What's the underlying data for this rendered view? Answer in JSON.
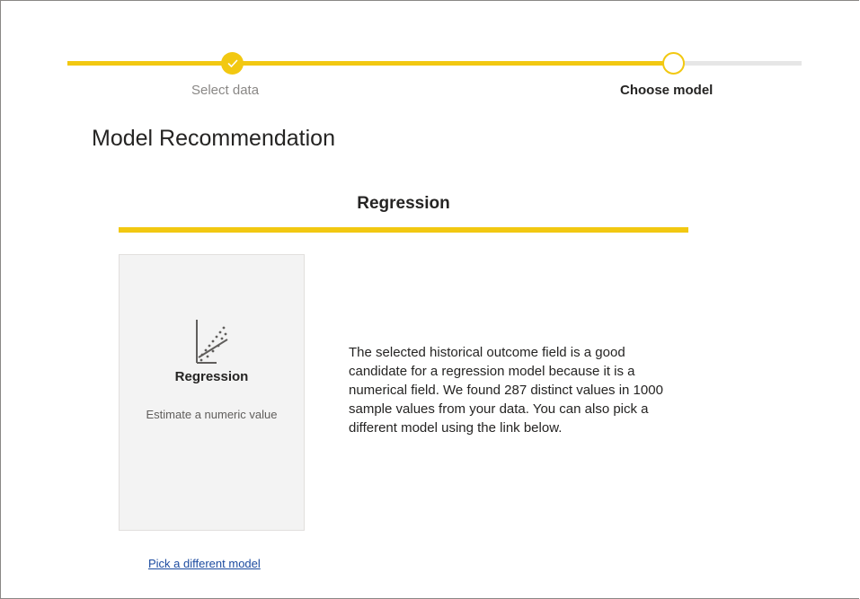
{
  "stepper": {
    "steps": [
      {
        "label": "Select data",
        "state": "done"
      },
      {
        "label": "Choose model",
        "state": "current"
      }
    ],
    "accent_color": "#f2c811"
  },
  "page": {
    "title": "Model Recommendation"
  },
  "tab": {
    "label": "Regression"
  },
  "model_card": {
    "icon": "regression-scatter-icon",
    "name": "Regression",
    "description": "Estimate a numeric value"
  },
  "recommendation": {
    "text": "The selected historical outcome field is a good candidate for a regression model because it is a numerical field. We found 287 distinct values in 1000 sample values from your data. You can also pick a different model using the link below."
  },
  "links": {
    "pick_different_model": "Pick a different model"
  }
}
